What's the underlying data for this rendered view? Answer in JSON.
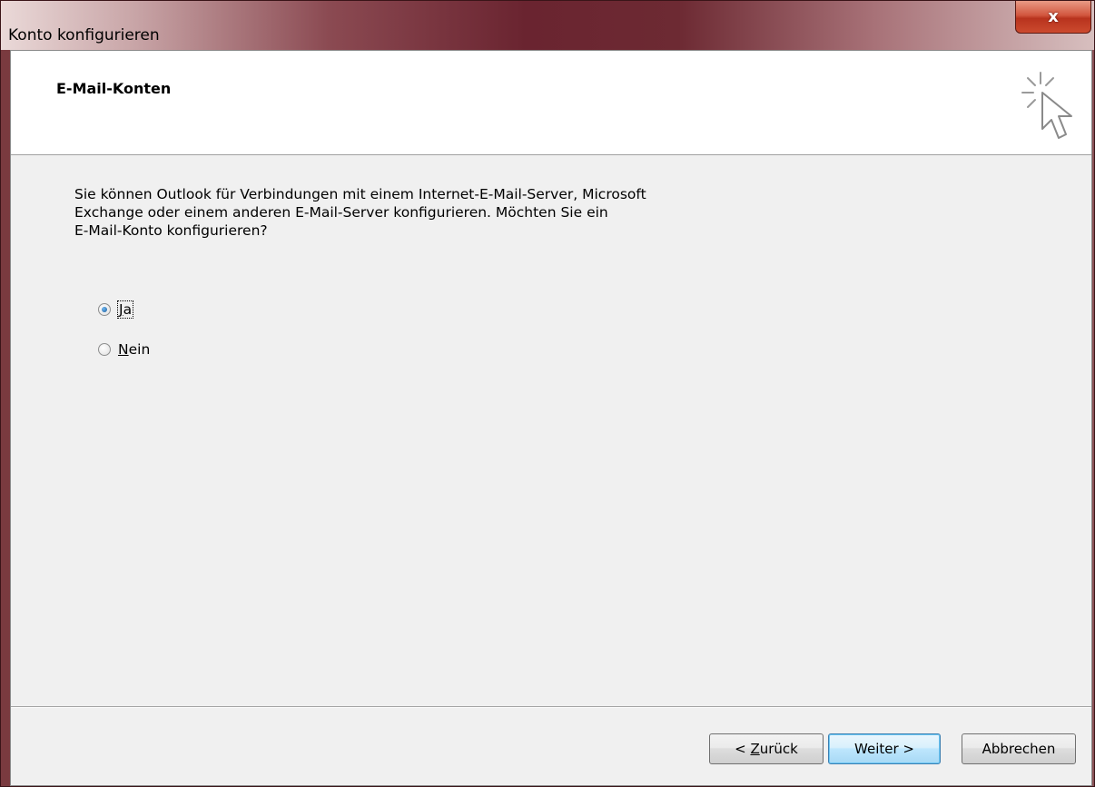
{
  "window": {
    "title": "Konto konfigurieren",
    "close_symbol": "x"
  },
  "header": {
    "title": "E-Mail-Konten",
    "icon": "wizard-cursor-icon"
  },
  "body": {
    "description": "Sie können Outlook für Verbindungen mit einem Internet-E-Mail-Server, Microsoft\nExchange oder einem anderen E-Mail-Server konfigurieren. Möchten Sie ein\nE-Mail-Konto konfigurieren?",
    "options": [
      {
        "accel": "J",
        "rest": "a",
        "checked": true
      },
      {
        "accel": "N",
        "rest": "ein",
        "checked": false
      }
    ]
  },
  "footer": {
    "back_prefix": "< ",
    "back_accel": "Z",
    "back_rest": "urück",
    "next_label": "Weiter >",
    "cancel_label": "Abbrechen"
  },
  "colors": {
    "title_gradient_dark": "#6a2430",
    "close_button": "#c8452a",
    "default_button_border": "#3c7fb1",
    "client_bg": "#f0f0f0"
  }
}
